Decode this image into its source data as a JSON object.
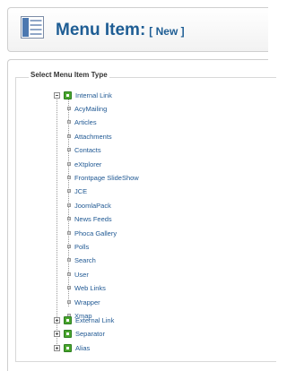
{
  "header": {
    "title": "Menu Item:",
    "tag": "[ New ]"
  },
  "panel": {
    "legend": "Select Menu Item Type"
  },
  "tree": {
    "internal_link": {
      "label": "Internal Link",
      "children": [
        "AcyMailing",
        "Articles",
        "Attachments",
        "Contacts",
        "eXtplorer",
        "Frontpage SlideShow",
        "JCE",
        "JoomlaPack",
        "News Feeds",
        "Phoca Gallery",
        "Polls",
        "Search",
        "User",
        "Web Links",
        "Wrapper",
        "Xmap"
      ]
    },
    "external_link": {
      "label": "External Link"
    },
    "separator": {
      "label": "Separator"
    },
    "alias": {
      "label": "Alias"
    }
  },
  "colors": {
    "title": "#1e5d94",
    "link": "#1f5893",
    "icon_green": "#4aa52e"
  }
}
